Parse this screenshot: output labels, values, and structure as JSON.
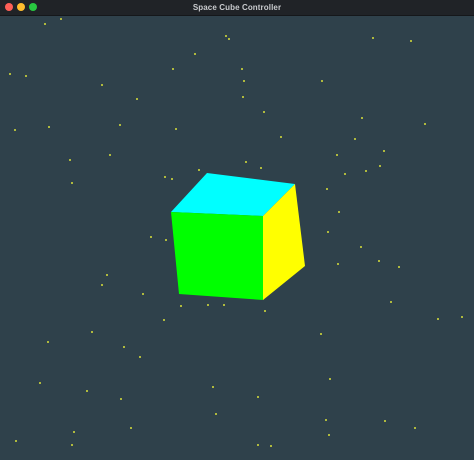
{
  "window": {
    "title": "Space Cube Controller"
  },
  "scene": {
    "background_color": "#2f414b",
    "star_color": "#d9df3a",
    "star_count": 95,
    "cube": {
      "face_colors": {
        "top": "#00ffff",
        "front": "#00ff00",
        "right": "#ffff00"
      }
    }
  }
}
